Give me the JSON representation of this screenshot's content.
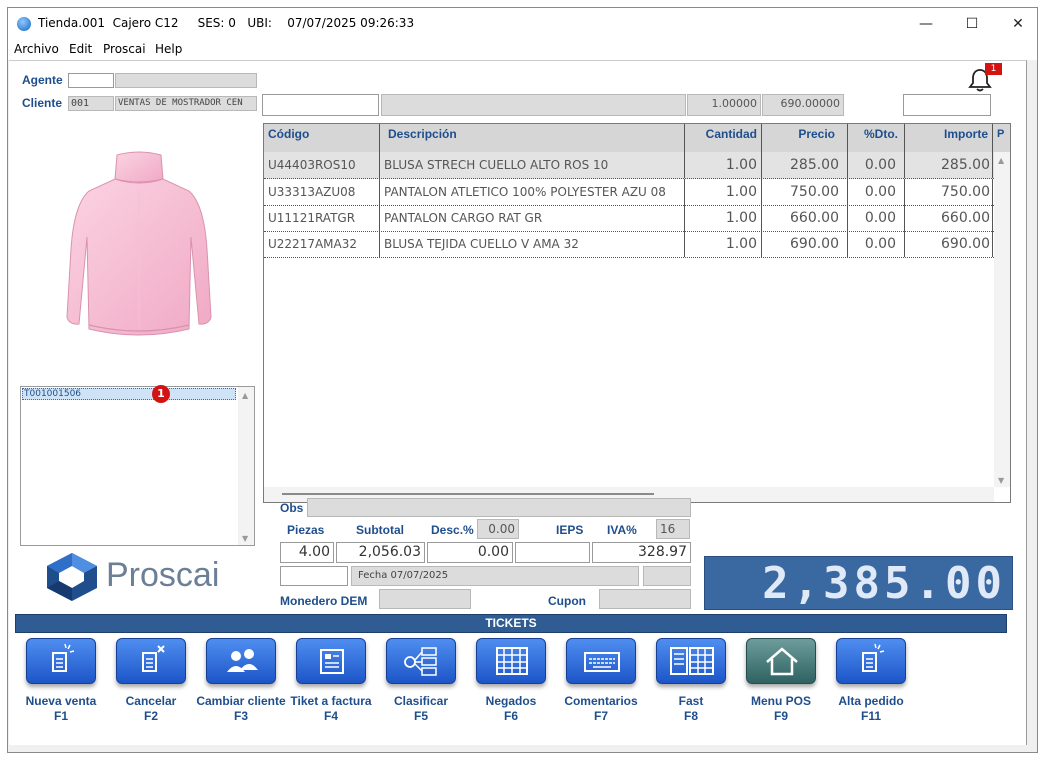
{
  "window": {
    "title": "Tienda.001  Cajero C12     SES: 0   UBI:    07/07/2025 09:26:33",
    "minimize_glyph": "—",
    "maximize_glyph": "☐",
    "close_glyph": "✕"
  },
  "menu": [
    "Archivo",
    "Edit",
    "Proscai",
    "Help"
  ],
  "notifications": {
    "count": "1"
  },
  "header": {
    "agente_label": "Agente",
    "cliente_label": "Cliente",
    "cliente_code": "001",
    "cliente_name": "VENTAS DE MOSTRADOR CEN"
  },
  "entry": {
    "cantidad": "1.00000",
    "precio": "690.00000"
  },
  "ticket_list": {
    "items": [
      "T001001506"
    ],
    "badge": "1"
  },
  "table": {
    "columns": [
      "Código",
      "Descripción",
      "Cantidad",
      "Precio",
      "%Dto.",
      "Importe",
      "P"
    ],
    "rows": [
      {
        "codigo": "U44403ROS10",
        "descripcion": "BLUSA STRECH CUELLO ALTO ROS 10",
        "cantidad": "1.00",
        "precio": "285.00",
        "dto": "0.00",
        "importe": "285.00"
      },
      {
        "codigo": "U33313AZU08",
        "descripcion": "PANTALON ATLETICO 100% POLYESTER AZU 08",
        "cantidad": "1.00",
        "precio": "750.00",
        "dto": "0.00",
        "importe": "750.00"
      },
      {
        "codigo": "U11121RATGR",
        "descripcion": "PANTALON CARGO RAT GR",
        "cantidad": "1.00",
        "precio": "660.00",
        "dto": "0.00",
        "importe": "660.00"
      },
      {
        "codigo": "U22217AMA32",
        "descripcion": "BLUSA TEJIDA CUELLO V AMA 32",
        "cantidad": "1.00",
        "precio": "690.00",
        "dto": "0.00",
        "importe": "690.00"
      }
    ]
  },
  "summary": {
    "obs_label": "Obs",
    "piezas_label": "Piezas",
    "subtotal_label": "Subtotal",
    "desc_label": "Desc.%",
    "desc_pct": "0.00",
    "ieps_label": "IEPS",
    "iva_label": "IVA%",
    "iva_pct": "16",
    "piezas": "4.00",
    "subtotal": "2,056.03",
    "descuento": "0.00",
    "ieps": "",
    "iva": "328.97",
    "fecha": "Fecha 07/07/2025",
    "monedero_label": "Monedero DEM",
    "cupon_label": "Cupon",
    "total": "2,385.00"
  },
  "brand": {
    "name": "Proscai"
  },
  "tickets_bar": "TICKETS",
  "function_keys": [
    {
      "label": "Nueva venta",
      "key": "F1",
      "icon": "new-sale-icon"
    },
    {
      "label": "Cancelar",
      "key": "F2",
      "icon": "cancel-icon"
    },
    {
      "label": "Cambiar cliente",
      "key": "F3",
      "icon": "users-icon"
    },
    {
      "label": "Tiket a factura",
      "key": "F4",
      "icon": "invoice-icon"
    },
    {
      "label": "Clasificar",
      "key": "F5",
      "icon": "share-icon"
    },
    {
      "label": "Negados",
      "key": "F6",
      "icon": "grid-icon"
    },
    {
      "label": "Comentarios",
      "key": "F7",
      "icon": "keyboard-icon"
    },
    {
      "label": "Fast",
      "key": "F8",
      "icon": "table-icon"
    },
    {
      "label": "Menu POS",
      "key": "F9",
      "icon": "home-icon"
    },
    {
      "label": "Alta pedido",
      "key": "F11",
      "icon": "new-order-icon"
    }
  ],
  "colors": {
    "accent": "#1f4e8c",
    "total_bg": "#3a68a0",
    "button_blue": "#2a66d8",
    "badge_red": "#d31212"
  }
}
